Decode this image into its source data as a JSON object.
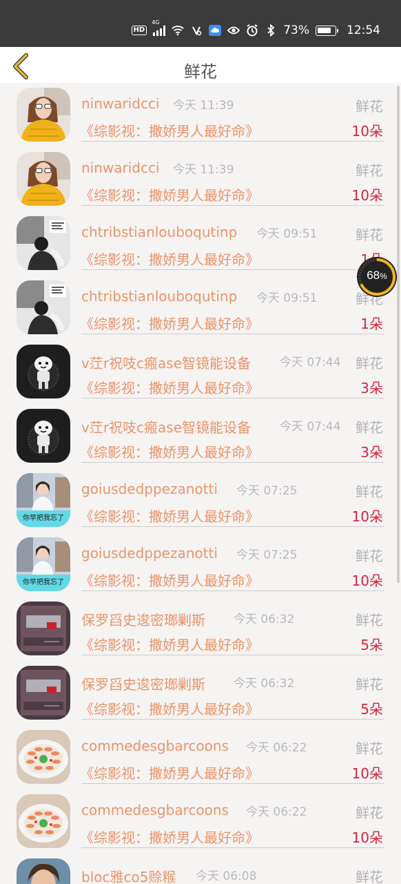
{
  "status_bar": {
    "hd": "HD",
    "network": "4G",
    "battery": "73%",
    "battery_level": 0.73,
    "time": "12:54",
    "icons": [
      "hd-icon",
      "signal-icon",
      "wifi-icon",
      "nfc-icon",
      "cloud-icon",
      "eye-icon",
      "alarm-icon",
      "bluetooth-icon",
      "battery-icon"
    ]
  },
  "header": {
    "title": "鲜花"
  },
  "speed_badge": {
    "value": "68",
    "unit": "%"
  },
  "rows": [
    {
      "user": "ninwaridcci",
      "time": "今天 11:39",
      "gift": "鲜花",
      "book": "《综影视：撒娇男人最好命》",
      "count": "10朵",
      "avatar": "avatar-girl-yellow-sweater"
    },
    {
      "user": "ninwaridcci",
      "time": "今天 11:39",
      "gift": "鲜花",
      "book": "《综影视：撒娇男人最好命》",
      "count": "10朵",
      "avatar": "avatar-girl-yellow-sweater"
    },
    {
      "user": "chtribstianlouboqutinp",
      "time": "今天 09:51",
      "gift": "鲜花",
      "book": "《综影视：撒娇男人最好命》",
      "count": "1朵",
      "avatar": "avatar-bw-couple"
    },
    {
      "user": "chtribstianlouboqutinp",
      "time": "今天 09:51",
      "gift": "鲜花",
      "book": "《综影视：撒娇男人最好命》",
      "count": "1朵",
      "avatar": "avatar-bw-couple"
    },
    {
      "user": "v茳r祝吱c瘢ase智镜能设备",
      "time": "今天 07:44",
      "gift": "鲜花",
      "book": "《综影视：撒娇男人最好命》",
      "count": "3朵",
      "avatar": "avatar-cartoon-dark"
    },
    {
      "user": "v茳r祝吱c瘢ase智镜能设备",
      "time": "今天 07:44",
      "gift": "鲜花",
      "book": "《综影视：撒娇男人最好命》",
      "count": "3朵",
      "avatar": "avatar-cartoon-dark"
    },
    {
      "user": "goiusdedppezanotti",
      "time": "今天 07:25",
      "gift": "鲜花",
      "book": "《综影视：撒娇男人最好命》",
      "count": "10朵",
      "avatar": "avatar-girl-street",
      "avatar_caption": "你早把我忘了"
    },
    {
      "user": "goiusdedppezanotti",
      "time": "今天 07:25",
      "gift": "鲜花",
      "book": "《综影视：撒娇男人最好命》",
      "count": "10朵",
      "avatar": "avatar-girl-street",
      "avatar_caption": "你早把我忘了"
    },
    {
      "user": "保罗舀史逡密瑯剿斯",
      "time": "今天 06:32",
      "gift": "鲜花",
      "book": "《综影视：撒娇男人最好命》",
      "count": "5朵",
      "avatar": "avatar-dark-red"
    },
    {
      "user": "保罗舀史逡密瑯剿斯",
      "time": "今天 06:32",
      "gift": "鲜花",
      "book": "《综影视：撒娇男人最好命》",
      "count": "5朵",
      "avatar": "avatar-dark-red"
    },
    {
      "user": "commedesgbarcoons",
      "time": "今天 06:22",
      "gift": "鲜花",
      "book": "《综影视：撒娇男人最好命》",
      "count": "10朵",
      "avatar": "avatar-food-plate"
    },
    {
      "user": "commedesgbarcoons",
      "time": "今天 06:22",
      "gift": "鲜花",
      "book": "《综影视：撒娇男人最好命》",
      "count": "10朵",
      "avatar": "avatar-food-plate"
    },
    {
      "user": "bloc雅co5赊糇",
      "time": "今天 06:08",
      "gift": "鲜花",
      "book": "",
      "count": "",
      "avatar": "avatar-boy-portrait"
    }
  ]
}
